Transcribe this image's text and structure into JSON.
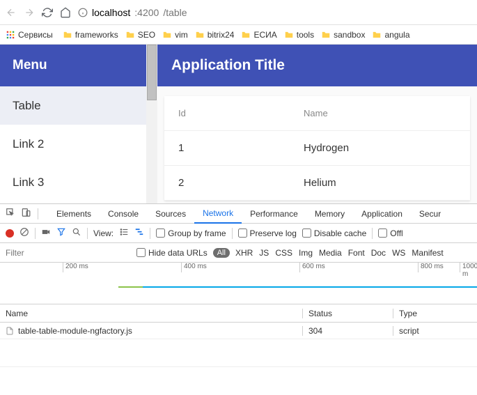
{
  "browser": {
    "url_prefix": "localhost",
    "url_port": ":4200",
    "url_path": "/table"
  },
  "bookmarks": {
    "apps": "Сервисы",
    "items": [
      "frameworks",
      "SEO",
      "vim",
      "bitrix24",
      "ЕСИА",
      "tools",
      "sandbox",
      "angula"
    ]
  },
  "app": {
    "menu_title": "Menu",
    "menu_items": [
      "Table",
      "Link 2",
      "Link 3"
    ],
    "app_title": "Application Title",
    "table": {
      "headers": {
        "id": "Id",
        "name": "Name"
      },
      "rows": [
        {
          "id": "1",
          "name": "Hydrogen"
        },
        {
          "id": "2",
          "name": "Helium"
        }
      ]
    }
  },
  "devtools": {
    "tabs": [
      "Elements",
      "Console",
      "Sources",
      "Network",
      "Performance",
      "Memory",
      "Application",
      "Secur"
    ],
    "active_tab": "Network",
    "row2": {
      "view_label": "View:",
      "group": "Group by frame",
      "preserve": "Preserve log",
      "disable_cache": "Disable cache",
      "offline": "Offl"
    },
    "row3": {
      "filter_placeholder": "Filter",
      "hide_data": "Hide data URLs",
      "all": "All",
      "types": [
        "XHR",
        "JS",
        "CSS",
        "Img",
        "Media",
        "Font",
        "Doc",
        "WS",
        "Manifest"
      ]
    },
    "timeline": [
      "200 ms",
      "400 ms",
      "600 ms",
      "800 ms",
      "1000 m"
    ],
    "net_headers": {
      "name": "Name",
      "status": "Status",
      "type": "Type"
    },
    "net_rows": [
      {
        "name": "table-table-module-ngfactory.js",
        "status": "304",
        "type": "script"
      }
    ]
  }
}
